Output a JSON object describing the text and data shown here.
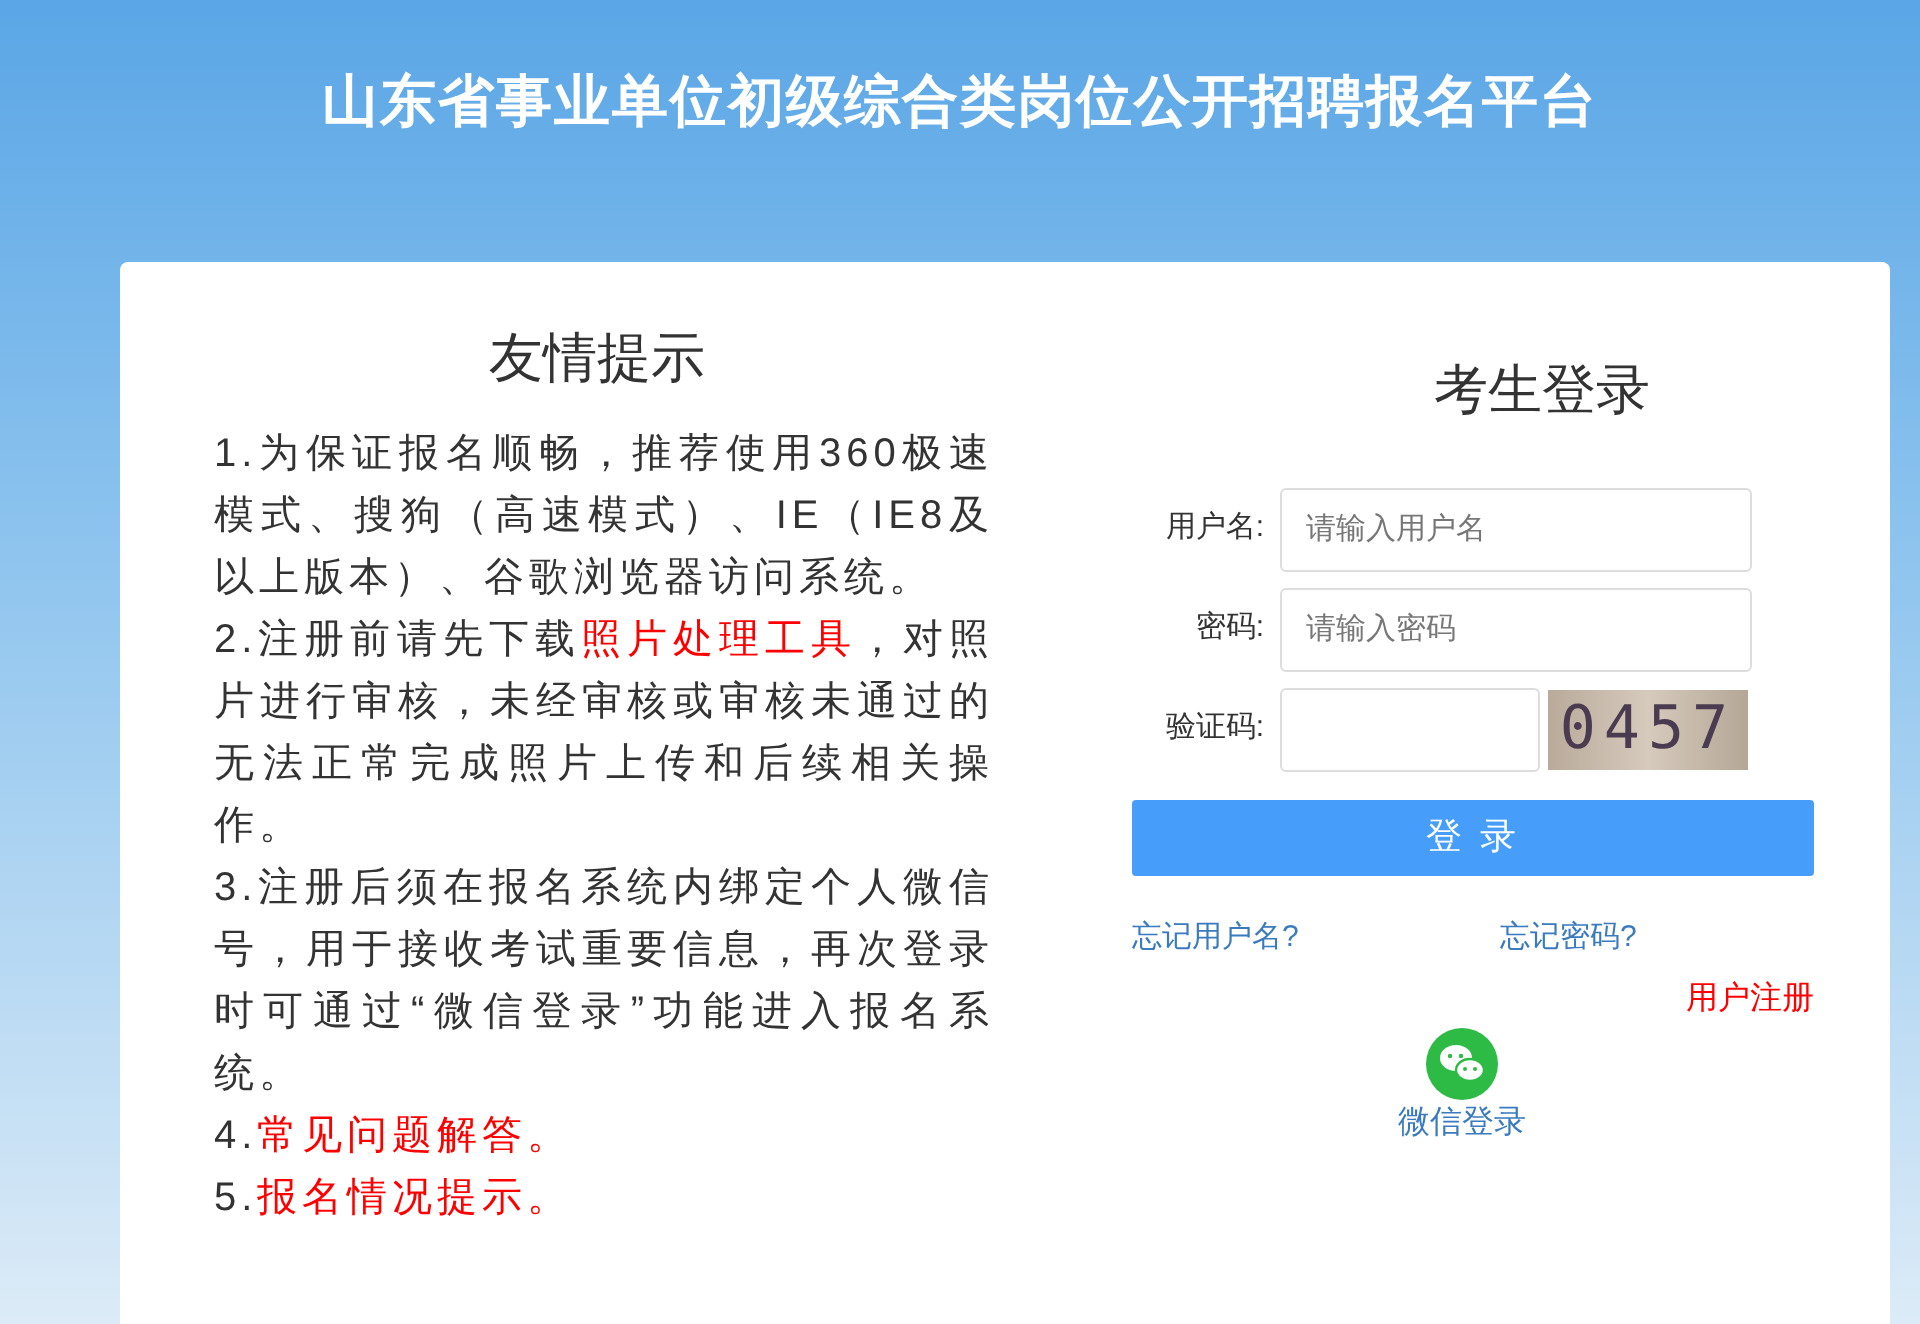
{
  "header": {
    "title": "山东省事业单位初级综合类岗位公开招聘报名平台"
  },
  "tips": {
    "title": "友情提示",
    "items": [
      {
        "parts": [
          {
            "kind": "plain",
            "text": "1.为保证报名顺畅，推荐使用360极速模式、搜狗（高速模式）、IE（IE8及以上版本）、谷歌浏览器访问系统。"
          }
        ]
      },
      {
        "parts": [
          {
            "kind": "plain",
            "text": "2.注册前请先下载"
          },
          {
            "kind": "link",
            "text": "照片处理工具"
          },
          {
            "kind": "plain",
            "text": "，对照片进行审核，未经审核或审核未通过的无法正常完成照片上传和后续相关操作。"
          }
        ]
      },
      {
        "parts": [
          {
            "kind": "plain",
            "text": "3.注册后须在报名系统内绑定个人微信号，用于接收考试重要信息，再次登录时可通过“微信登录”功能进入报名系统。"
          }
        ]
      },
      {
        "parts": [
          {
            "kind": "plain",
            "text": "4."
          },
          {
            "kind": "link",
            "text": "常见问题解答。"
          }
        ]
      },
      {
        "parts": [
          {
            "kind": "plain",
            "text": "5."
          },
          {
            "kind": "link",
            "text": "报名情况提示。"
          }
        ]
      }
    ]
  },
  "login": {
    "title": "考生登录",
    "fields": [
      {
        "label": "用户名:",
        "placeholder": "请输入用户名"
      },
      {
        "label": "密码:",
        "placeholder": "请输入密码"
      }
    ],
    "captcha": {
      "label": "验证码:",
      "code": "0457"
    },
    "submit": "登 录",
    "forgot_username": "忘记用户名?",
    "forgot_password": "忘记密码?",
    "register": "用户注册",
    "wechat_login": "微信登录"
  }
}
